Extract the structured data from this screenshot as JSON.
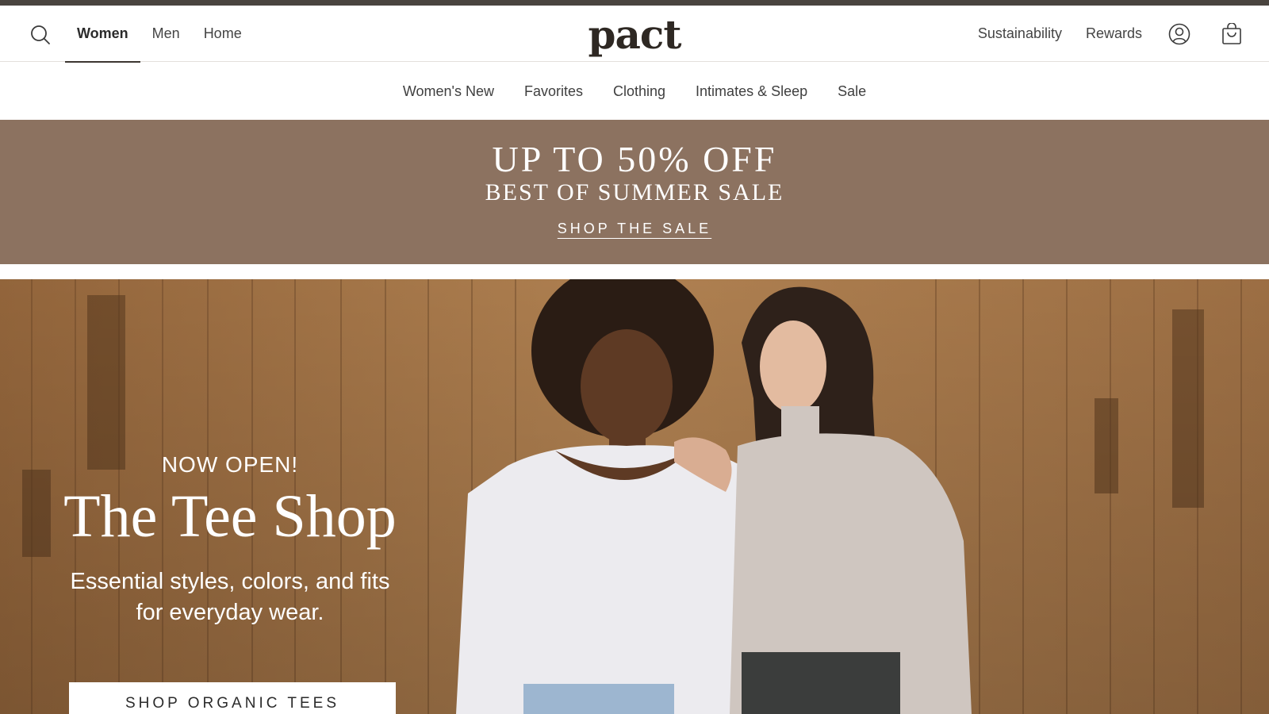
{
  "header": {
    "logo_text": "pact",
    "primary_nav": [
      {
        "label": "Women",
        "active": true
      },
      {
        "label": "Men",
        "active": false
      },
      {
        "label": "Home",
        "active": false
      }
    ],
    "right_links": {
      "sustainability": "Sustainability",
      "rewards": "Rewards"
    },
    "icons": [
      "search-icon",
      "account-icon",
      "shopping-bag-icon"
    ]
  },
  "subnav": {
    "items": [
      "Women's New",
      "Favorites",
      "Clothing",
      "Intimates & Sleep",
      "Sale"
    ]
  },
  "sale_banner": {
    "headline": "UP TO 50% OFF",
    "subheadline": "BEST OF SUMMER SALE",
    "cta": "SHOP THE SALE"
  },
  "hero": {
    "eyebrow": "NOW OPEN!",
    "title": "The Tee Shop",
    "subtitle_line1": "Essential styles, colors, and fits",
    "subtitle_line2": "for everyday wear.",
    "cta": "SHOP ORGANIC TEES"
  },
  "colors": {
    "top_strip": "#4a443f",
    "sale_banner_bg": "#8c7260",
    "hero_wood": "#a9794a",
    "text_dark": "#2b2b2b"
  }
}
